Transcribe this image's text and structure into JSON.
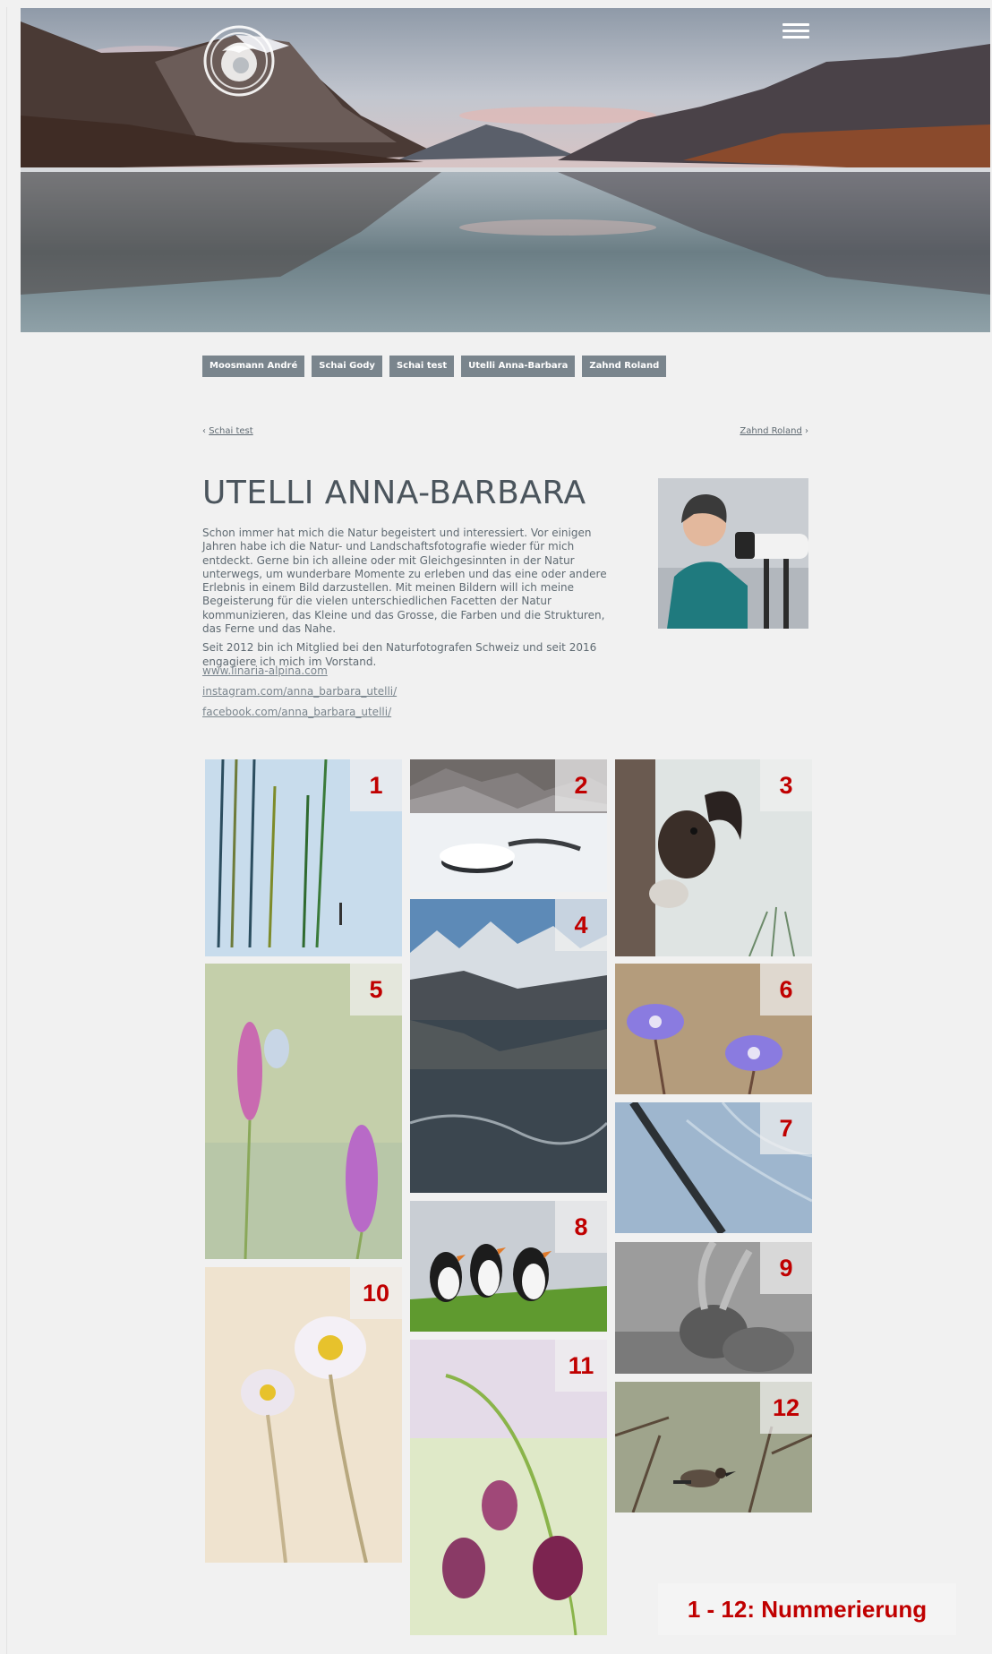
{
  "header": {
    "logo_icon": "club-logo-icon",
    "menu_icon": "hamburger-menu-icon"
  },
  "members_nav": [
    {
      "label": "Moosmann André"
    },
    {
      "label": "Schai Gody"
    },
    {
      "label": "Schai test"
    },
    {
      "label": "Utelli Anna-Barbara"
    },
    {
      "label": "Zahnd Roland"
    }
  ],
  "pager": {
    "prev_label": "Schai test",
    "next_label": "Zahnd Roland",
    "prev_icon": "chevron-left-icon",
    "next_icon": "chevron-right-icon"
  },
  "profile": {
    "name": "UTELLI ANNA-BARBARA",
    "bio_p1": "Schon immer hat mich die Natur begeistert und interessiert. Vor einigen Jahren habe ich die Natur- und Landschaftsfotografie wieder für mich entdeckt. Gerne bin ich alleine oder mit Gleichgesinnten in der Natur unterwegs, um wunderbare Momente zu erleben und das eine oder andere Erlebnis in einem Bild darzustellen. Mit meinen Bildern will ich meine Begeisterung für die vielen unterschiedlichen Facetten der Natur kommunizieren, das Kleine und das Grosse, die Farben und die Strukturen, das Ferne und das Nahe.",
    "bio_p2": "Seit 2012 bin ich Mitglied bei den Naturfotografen Schweiz und seit 2016 engagiere ich mich im Vorstand.",
    "links": [
      "www.linaria-alpina.com",
      "instagram.com/anna_barbara_utelli/",
      "facebook.com/anna_barbara_utelli/"
    ]
  },
  "gallery": {
    "numbers": [
      "1",
      "2",
      "3",
      "4",
      "5",
      "6",
      "7",
      "8",
      "9",
      "10",
      "11",
      "12"
    ],
    "legend": "1 - 12: Nummerierung"
  },
  "colors": {
    "badge_text": "#c00000",
    "nav_button_bg": "#7a858d",
    "page_bg": "#f1f1f1"
  }
}
